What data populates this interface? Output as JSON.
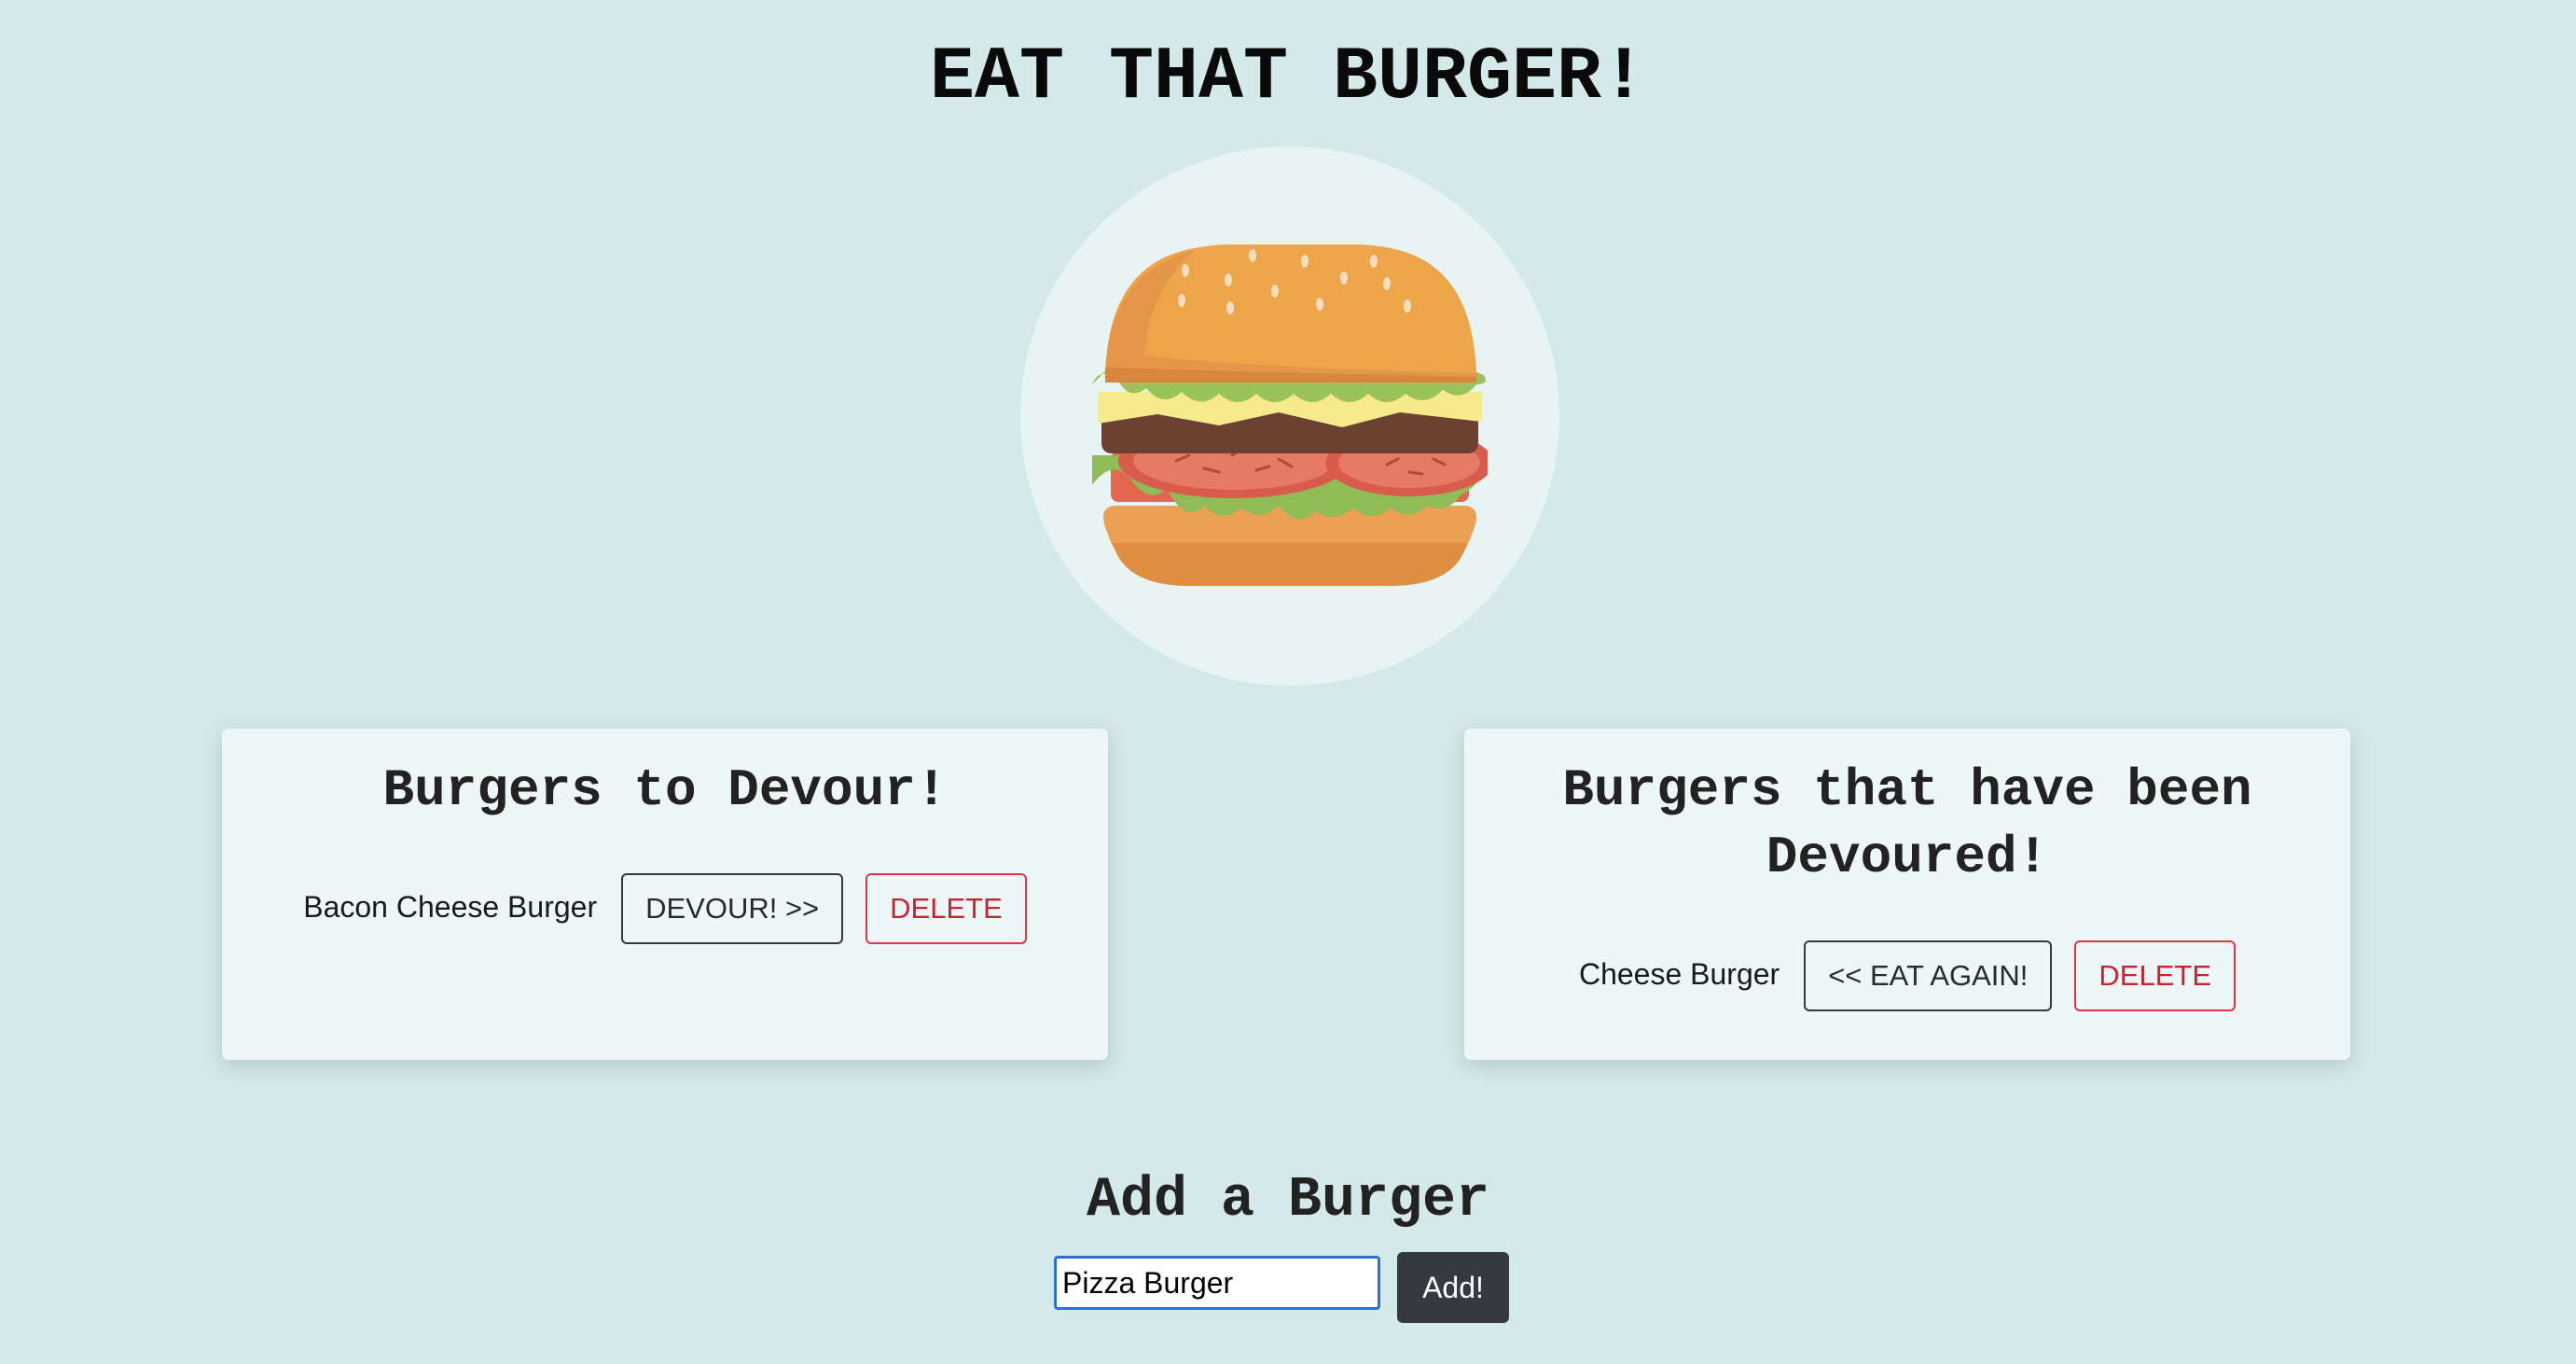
{
  "header": {
    "title": "EAT THAT BURGER!"
  },
  "logo": {
    "icon": "burger-icon"
  },
  "to_devour": {
    "heading": "Burgers to Devour!",
    "items": [
      {
        "name": "Bacon Cheese Burger",
        "action_label": "DEVOUR! >>",
        "delete_label": "DELETE"
      }
    ]
  },
  "devoured": {
    "heading": "Burgers that have been Devoured!",
    "items": [
      {
        "name": "Cheese Burger",
        "action_label": "<< EAT AGAIN!",
        "delete_label": "DELETE"
      }
    ]
  },
  "add_form": {
    "heading": "Add a Burger",
    "input_value": "Pizza Burger",
    "button_label": "Add!"
  },
  "colors": {
    "background": "#d4e9e9",
    "panel": "#eef7f7",
    "danger": "#dc3545",
    "dark": "#343a40"
  }
}
